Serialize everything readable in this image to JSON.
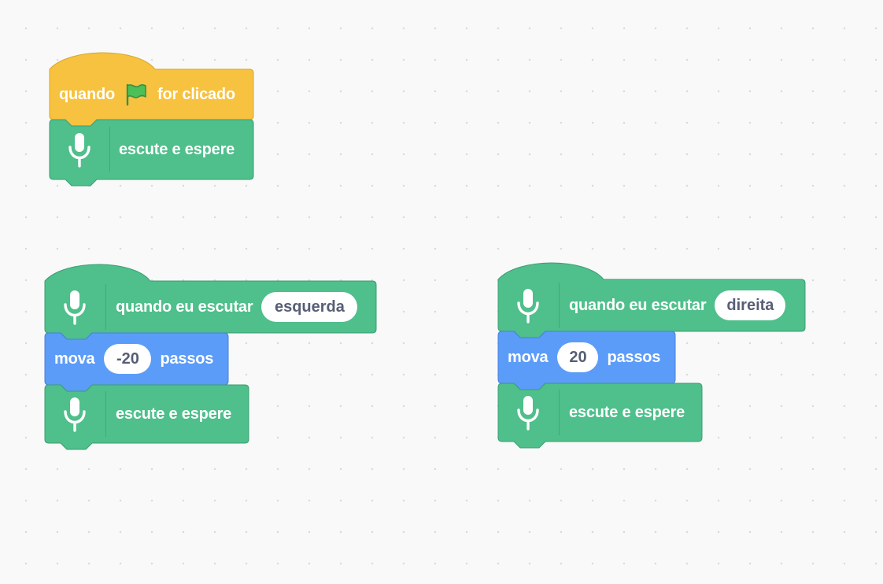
{
  "scripts": [
    {
      "hat": {
        "label_before": "quando",
        "icon": "green-flag-icon",
        "label_after": "for clicado"
      },
      "stack": [
        {
          "kind": "listen",
          "icon": "microphone-icon",
          "label": "escute e espere"
        }
      ]
    },
    {
      "hat": {
        "icon": "microphone-icon",
        "label": "quando eu escutar",
        "value": "esquerda"
      },
      "stack": [
        {
          "kind": "motion",
          "label": "mova",
          "value": "-20",
          "suffix": "passos"
        },
        {
          "kind": "listen",
          "icon": "microphone-icon",
          "label": "escute e espere"
        }
      ]
    },
    {
      "hat": {
        "icon": "microphone-icon",
        "label": "quando eu escutar",
        "value": "direita"
      },
      "stack": [
        {
          "kind": "motion",
          "label": "mova",
          "value": "20",
          "suffix": "passos"
        },
        {
          "kind": "listen",
          "icon": "microphone-icon",
          "label": "escute e espere"
        }
      ]
    }
  ],
  "colors": {
    "events": "#ffbf00",
    "events_border": "#cc9900",
    "extension": "#0fbd8c",
    "extension_border": "#0b8e69",
    "motion": "#4c97ff",
    "motion_border": "#3373cc",
    "flag": "#4cbf56"
  }
}
